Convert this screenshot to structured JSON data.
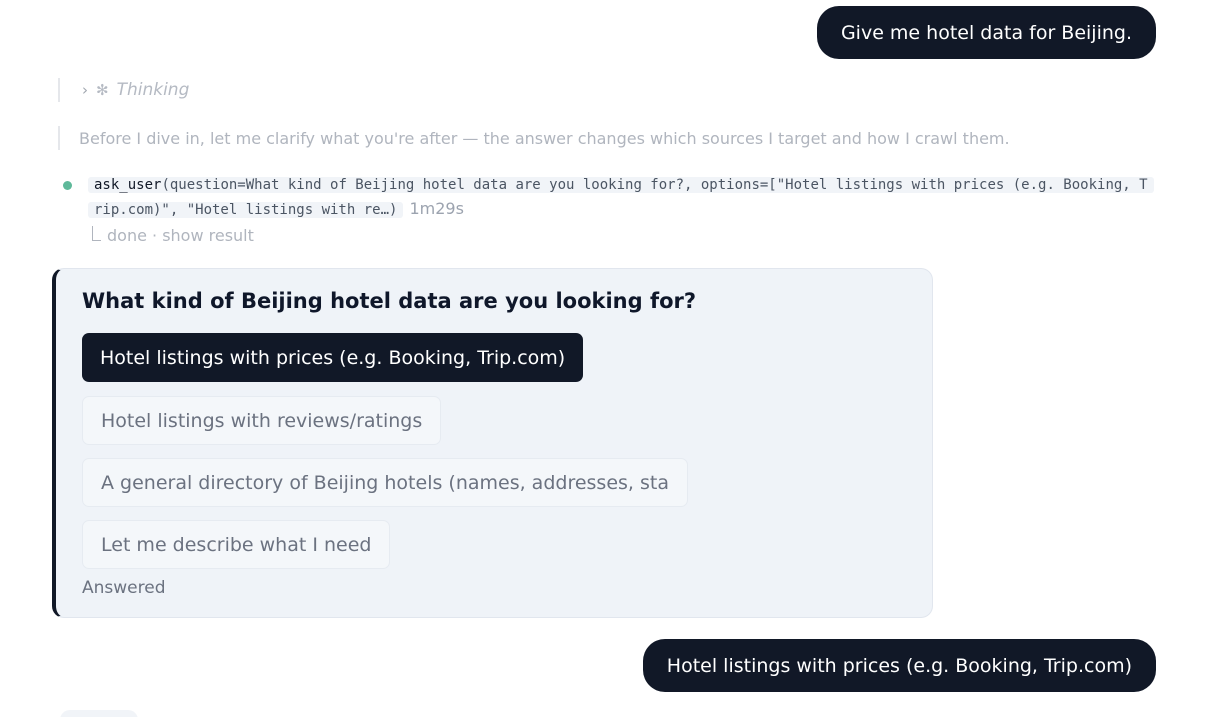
{
  "messages": {
    "user_prompt": "Give me hotel data for Beijing.",
    "user_answer": "Hotel listings with prices (e.g. Booking, Trip.com)"
  },
  "thinking": {
    "chevron_icon": "chevron-right",
    "sparkle_icon": "sparkle",
    "label": "Thinking"
  },
  "clarify_text": "Before I dive in, let me clarify what you're after — the answer changes which sources I target and how I crawl them.",
  "tool_call": {
    "status_color": "#5fb99a",
    "name": "ask_user",
    "args": "(question=What kind of Beijing hotel data are you looking for?, options=[\"Hotel listings with prices (e.g. Booking, Trip.com)\", \"Hotel listings with re…)",
    "duration": "1m29s",
    "status_text": "done · show result"
  },
  "question_card": {
    "title": "What kind of Beijing hotel data are you looking for?",
    "options": [
      {
        "label": "Hotel listings with prices (e.g. Booking, Trip.com)",
        "selected": true
      },
      {
        "label": "Hotel listings with reviews/ratings",
        "selected": false
      },
      {
        "label": "A general directory of Beijing hotels (names, addresses, sta",
        "selected": false
      },
      {
        "label": "Let me describe what I need",
        "selected": false
      }
    ],
    "status": "Answered"
  },
  "colors": {
    "accent_dark": "#111827",
    "card_bg": "#eff3f8",
    "status_green": "#5fb99a"
  }
}
